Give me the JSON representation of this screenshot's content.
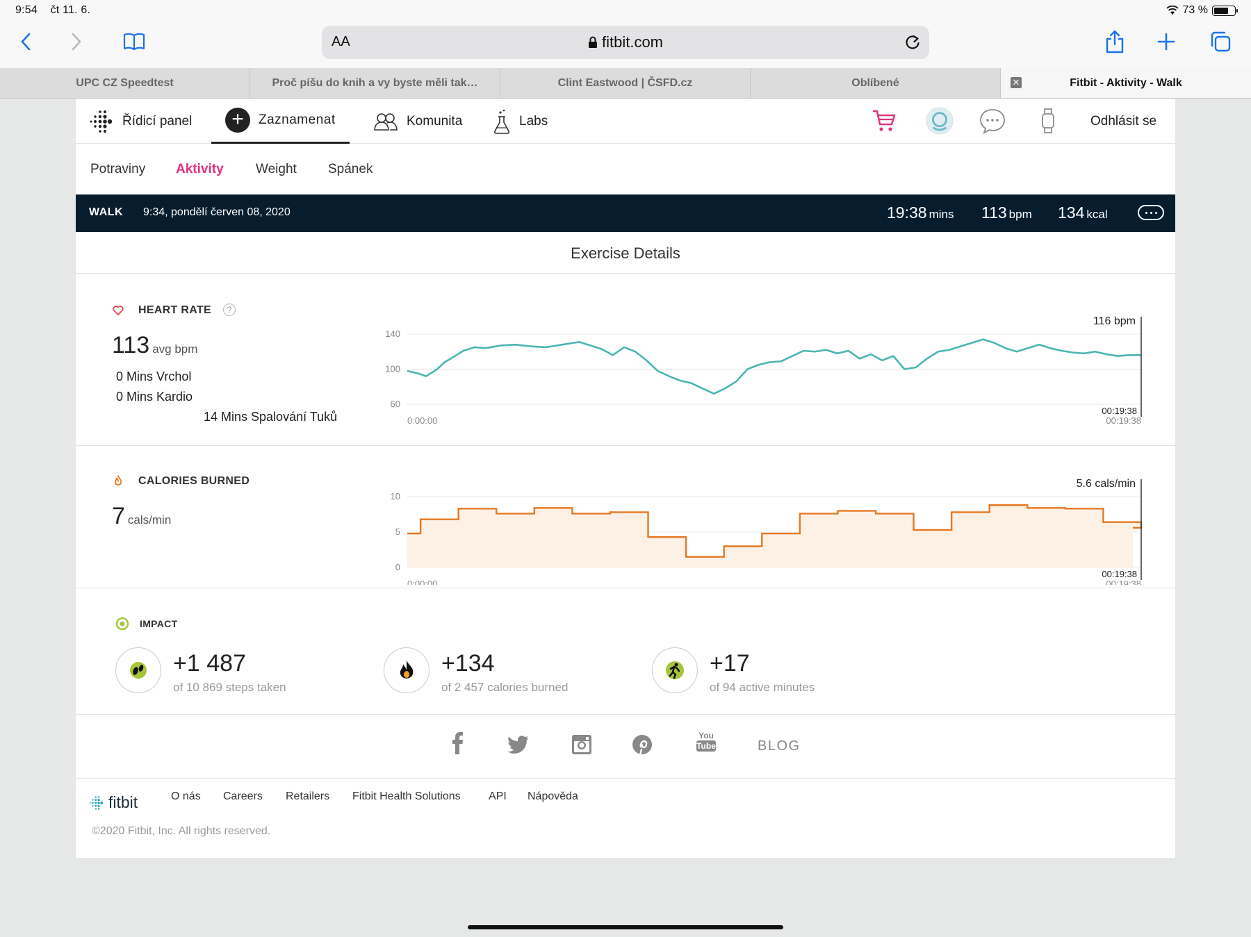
{
  "status": {
    "time": "9:54",
    "date": "čt 11. 6.",
    "battery": "73 %",
    "battery_level": 0.73
  },
  "browser": {
    "aa": "AA",
    "url": "fitbit.com",
    "tabs": [
      {
        "title": "UPC CZ Speedtest"
      },
      {
        "title": "Proč píšu do knih a vy byste měli tak…"
      },
      {
        "title": "Clint Eastwood | ČSFD.cz"
      },
      {
        "title": "Oblíbené"
      },
      {
        "title": "Fitbit - Aktivity - Walk"
      }
    ]
  },
  "topnav": {
    "dashboard": "Řídicí panel",
    "log": "Zaznamenat",
    "community": "Komunita",
    "labs": "Labs",
    "logout": "Odhlásit se"
  },
  "subnav": {
    "items": [
      "Potraviny",
      "Aktivity",
      "Weight",
      "Spánek"
    ],
    "active": "Aktivity"
  },
  "exercise": {
    "type": "WALK",
    "datetime": "9:34, pondělí červen 08, 2020",
    "duration": "19:38",
    "duration_unit": "mins",
    "bpm": "113",
    "bpm_unit": "bpm",
    "kcal": "134",
    "kcal_unit": "kcal",
    "details_title": "Exercise Details"
  },
  "heart_rate": {
    "label": "HEART RATE",
    "help": "?",
    "avg": "113",
    "avg_unit": "avg bpm",
    "zones": [
      "0 Mins Vrchol",
      "0 Mins Kardio",
      "14 Mins Spalování Tuků"
    ],
    "current": "116 bpm",
    "start_time": "0:00:00",
    "end_time_a": "00:19:38",
    "end_time_b": "00:19:38"
  },
  "calories": {
    "label": "CALORIES BURNED",
    "value": "7",
    "unit": "cals/min",
    "current": "5.6 cals/min",
    "start_time": "0:00:00",
    "end_time_a": "00:19:38",
    "end_time_b": "00:19:38"
  },
  "impact": {
    "label": "IMPACT",
    "items": [
      {
        "value": "+1 487",
        "sub": "of 10 869 steps taken"
      },
      {
        "value": "+134",
        "sub": "of 2 457 calories burned"
      },
      {
        "value": "+17",
        "sub": "of 94 active minutes"
      }
    ]
  },
  "social": {
    "youtube_top": "You",
    "youtube_bottom": "Tube",
    "blog": "BLOG"
  },
  "footer": {
    "brand": "fitbit",
    "links": [
      "O nás",
      "Careers",
      "Retailers",
      "Fitbit Health Solutions",
      "API",
      "Nápověda"
    ],
    "copyright": "©2020 Fitbit, Inc. All rights reserved."
  },
  "colors": {
    "heart_line": "#4bb5b2",
    "calorie_line": "#e87722",
    "calorie_fill": "#fdf1e6",
    "accent": "#e0347f",
    "header_bg": "#071d2e"
  },
  "chart_data": [
    {
      "type": "line",
      "title": "HEART RATE",
      "ylabel": "bpm",
      "ylim": [
        60,
        140
      ],
      "y_ticks": [
        60,
        100,
        140
      ],
      "x_range": [
        "0:00:00",
        "00:19:38"
      ],
      "series": [
        {
          "x": [
            0,
            0.3,
            0.5,
            0.8,
            1.0,
            1.2,
            1.5,
            1.8,
            2.1,
            2.5,
            2.9,
            3.3,
            3.7,
            4.0,
            4.3,
            4.6,
            4.9,
            5.2,
            5.5,
            5.8,
            6.1,
            6.4,
            6.7,
            7.0,
            7.3,
            7.6,
            7.9,
            8.2,
            8.5,
            8.8,
            9.1,
            9.4,
            9.7,
            10.0,
            10.3,
            10.6,
            10.9,
            11.2,
            11.5,
            11.8,
            12.1,
            12.4,
            12.7,
            13.0,
            13.3,
            13.6,
            13.9,
            14.2,
            14.5,
            14.8,
            15.1,
            15.4,
            15.7,
            16.0,
            16.3,
            16.6,
            16.9,
            17.2,
            17.5,
            17.8,
            18.1,
            18.4,
            18.7,
            19.0,
            19.3,
            19.63
          ],
          "values": [
            98,
            95,
            92,
            100,
            108,
            113,
            121,
            125,
            124,
            127,
            128,
            126,
            125,
            127,
            129,
            131,
            127,
            123,
            116,
            125,
            120,
            110,
            98,
            92,
            87,
            84,
            78,
            72,
            78,
            86,
            100,
            105,
            108,
            109,
            115,
            121,
            120,
            122,
            118,
            121,
            112,
            117,
            110,
            115,
            100,
            102,
            112,
            120,
            122,
            126,
            130,
            134,
            130,
            124,
            120,
            124,
            128,
            124,
            121,
            119,
            118,
            120,
            117,
            115,
            116,
            116
          ]
        }
      ]
    },
    {
      "type": "area",
      "title": "CALORIES BURNED",
      "ylabel": "cals/min",
      "ylim": [
        0,
        10
      ],
      "y_ticks": [
        0,
        5,
        10
      ],
      "x_range": [
        "0:00:00",
        "00:19:38"
      ],
      "series": [
        {
          "x": [
            0,
            0.35,
            1.35,
            2.35,
            3.35,
            4.35,
            5.35,
            6.35,
            7.35,
            8.35,
            9.35,
            10.35,
            11.35,
            12.35,
            13.35,
            14.35,
            15.35,
            16.35,
            17.35,
            18.35,
            19.35
          ],
          "values": [
            4.8,
            6.8,
            8.3,
            7.6,
            8.4,
            7.6,
            7.8,
            4.3,
            1.5,
            3.0,
            4.8,
            7.6,
            8.0,
            7.6,
            5.3,
            7.8,
            8.8,
            8.4,
            8.3,
            6.4,
            5.6
          ]
        }
      ]
    }
  ]
}
